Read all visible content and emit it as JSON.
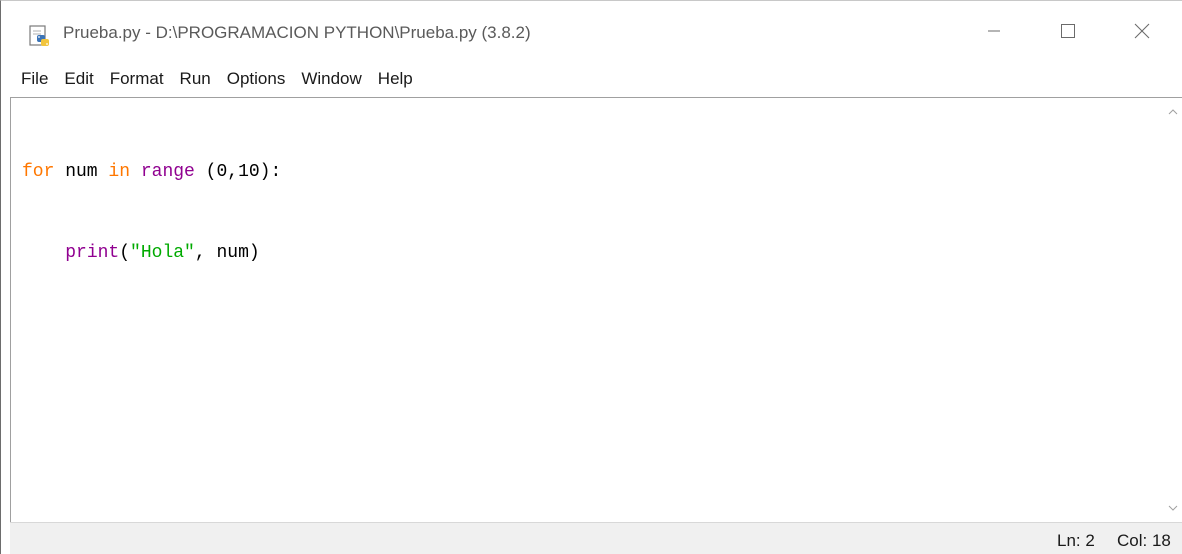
{
  "window": {
    "title": "Prueba.py - D:\\PROGRAMACION PYTHON\\Prueba.py (3.8.2)",
    "icon": "python-file-icon",
    "controls": {
      "minimize_icon": "minimize-icon",
      "maximize_icon": "maximize-icon",
      "close_icon": "close-icon"
    }
  },
  "menubar": {
    "items": [
      "File",
      "Edit",
      "Format",
      "Run",
      "Options",
      "Window",
      "Help"
    ]
  },
  "editor": {
    "lines": [
      [
        {
          "text": "for",
          "kind": "kw"
        },
        {
          "text": " num ",
          "kind": "plain"
        },
        {
          "text": "in",
          "kind": "kw"
        },
        {
          "text": " ",
          "kind": "plain"
        },
        {
          "text": "range",
          "kind": "builtin"
        },
        {
          "text": " (0,10):",
          "kind": "plain"
        }
      ],
      [
        {
          "text": "    ",
          "kind": "plain"
        },
        {
          "text": "print",
          "kind": "builtin"
        },
        {
          "text": "(",
          "kind": "plain"
        },
        {
          "text": "\"Hola\"",
          "kind": "str"
        },
        {
          "text": ", num)",
          "kind": "plain"
        }
      ]
    ],
    "colors": {
      "keyword": "#ff7700",
      "builtin": "#900090",
      "string": "#00aa00",
      "plain": "#000000"
    }
  },
  "statusbar": {
    "line": "Ln: 2",
    "column": "Col: 18"
  }
}
